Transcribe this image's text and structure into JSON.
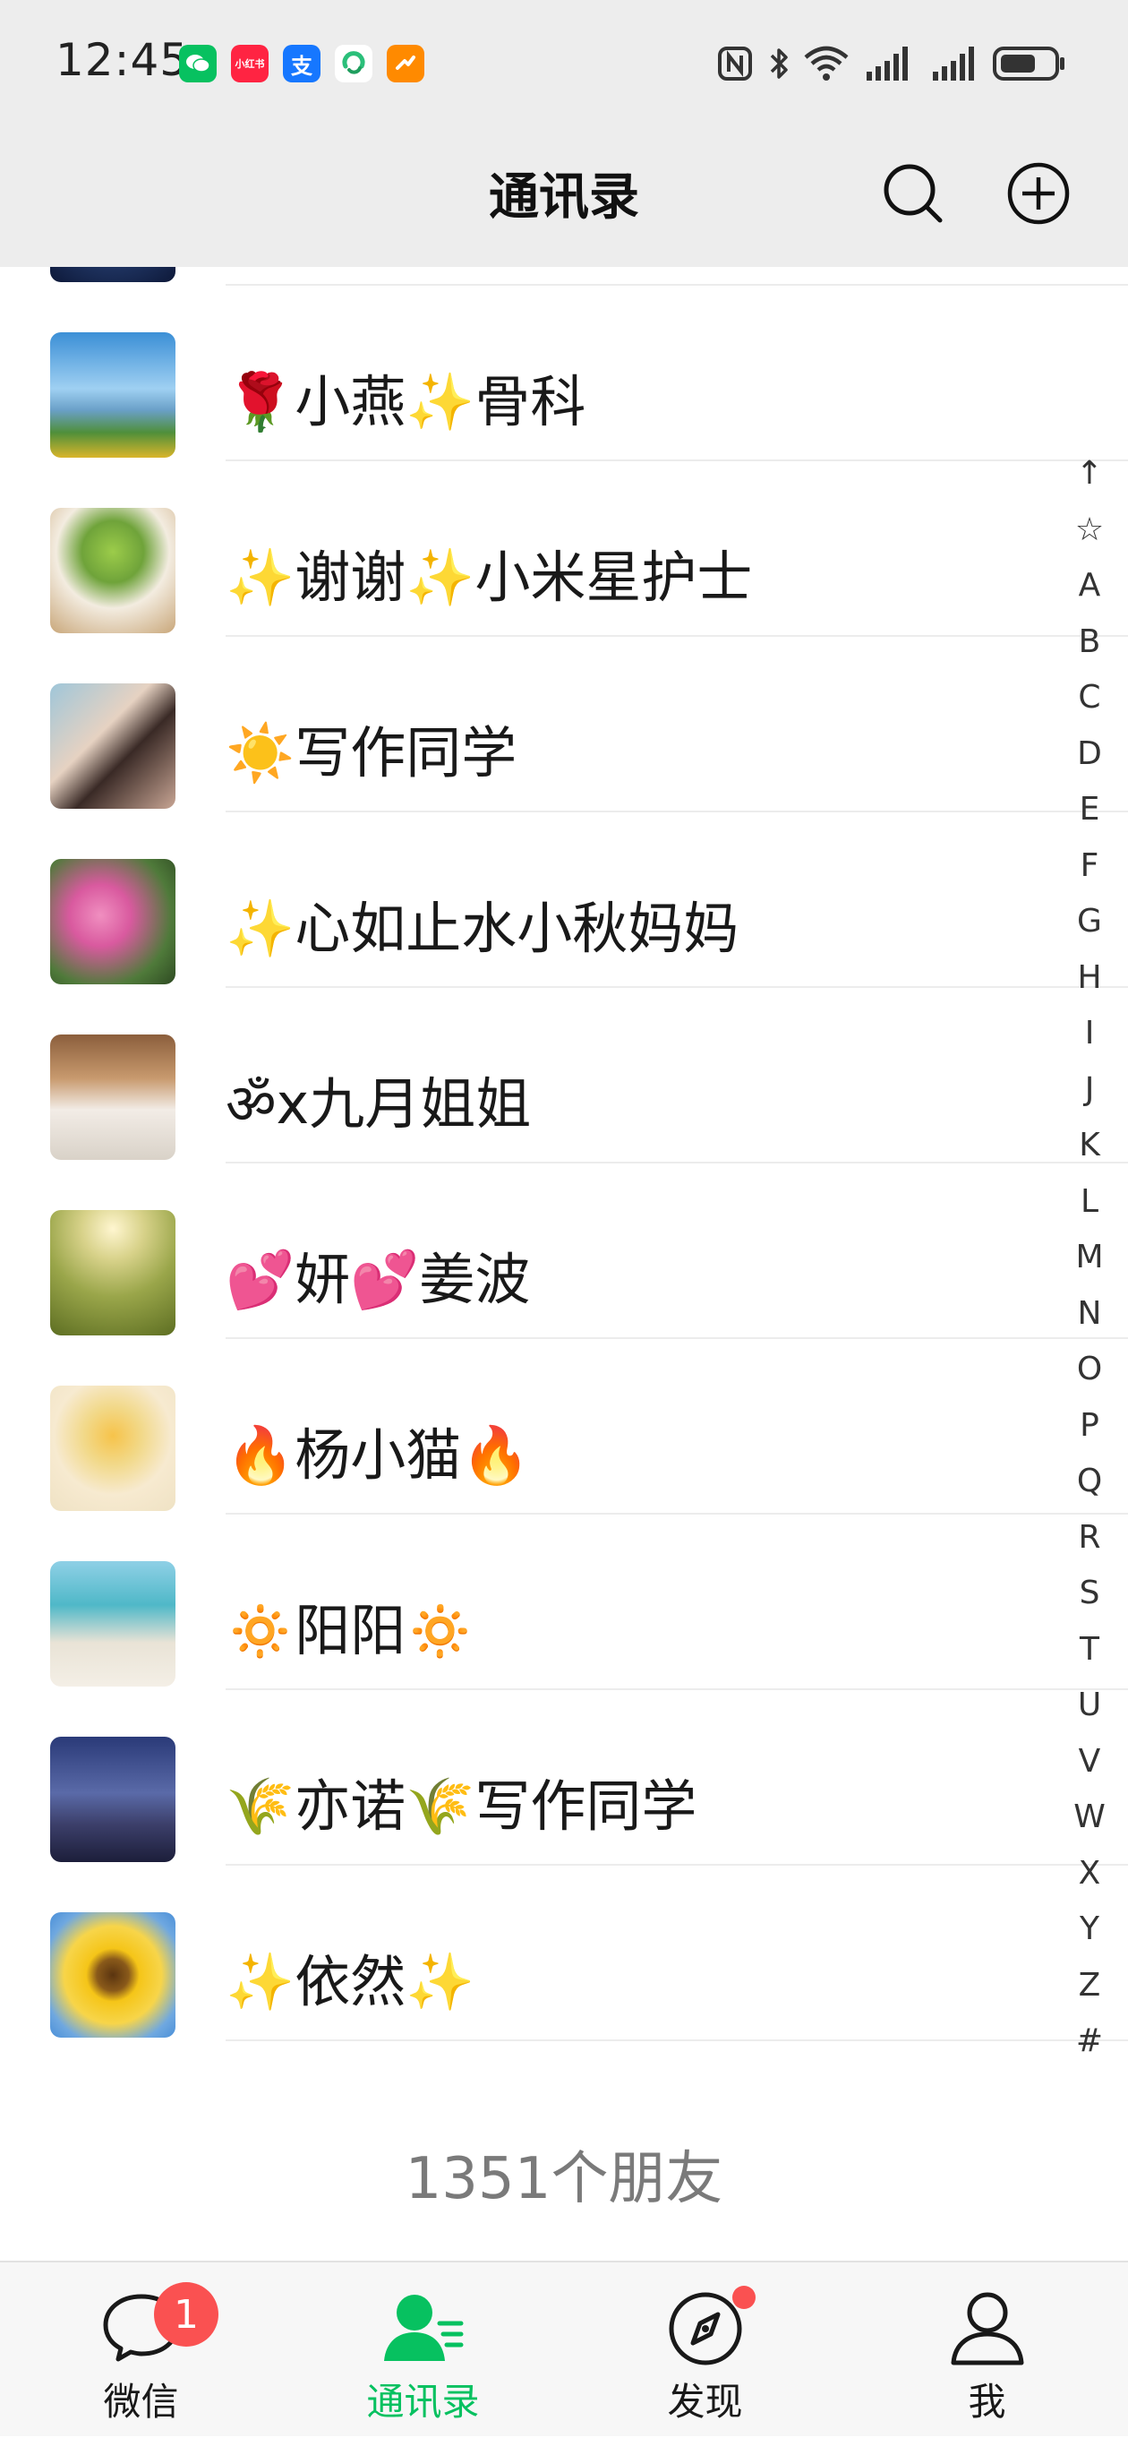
{
  "status_bar": {
    "time": "12:45",
    "notification_icons": [
      {
        "name": "wechat-notification-icon",
        "color": "#07c160",
        "label": ""
      },
      {
        "name": "xiaohongshu-notification-icon",
        "color": "#ff2442",
        "label": "小红书"
      },
      {
        "name": "alipay-notification-icon",
        "color": "#1677ff",
        "label": "支"
      },
      {
        "name": "app-notification-icon",
        "color": "#ffffff",
        "label": ""
      },
      {
        "name": "app-notification-icon-orange",
        "color": "#ff8a00",
        "label": ""
      }
    ]
  },
  "header": {
    "title": "通讯录"
  },
  "contacts": [
    {
      "name": ""
    },
    {
      "name": "🌹小燕✨骨科"
    },
    {
      "name": "✨谢谢✨小米星护士"
    },
    {
      "name": "☀️写作同学"
    },
    {
      "name": "✨心如止水小秋妈妈"
    },
    {
      "name": "ॐx九月姐姐"
    },
    {
      "name": "💕妍💕姜波"
    },
    {
      "name": "🔥杨小猫🔥"
    },
    {
      "name": "🔅阳阳🔅"
    },
    {
      "name": "🌾亦诺🌾写作同学"
    },
    {
      "name": "✨依然✨"
    }
  ],
  "index_letters": [
    "↑",
    "☆",
    "A",
    "B",
    "C",
    "D",
    "E",
    "F",
    "G",
    "H",
    "I",
    "J",
    "K",
    "L",
    "M",
    "N",
    "O",
    "P",
    "Q",
    "R",
    "S",
    "T",
    "U",
    "V",
    "W",
    "X",
    "Y",
    "Z",
    "#"
  ],
  "friend_count": "1351个朋友",
  "tabbar": {
    "tabs": [
      {
        "label": "微信",
        "badge": "1"
      },
      {
        "label": "通讯录"
      },
      {
        "label": "发现"
      },
      {
        "label": "我"
      }
    ],
    "active_color": "#07c160",
    "badge_color": "#fa5151"
  }
}
